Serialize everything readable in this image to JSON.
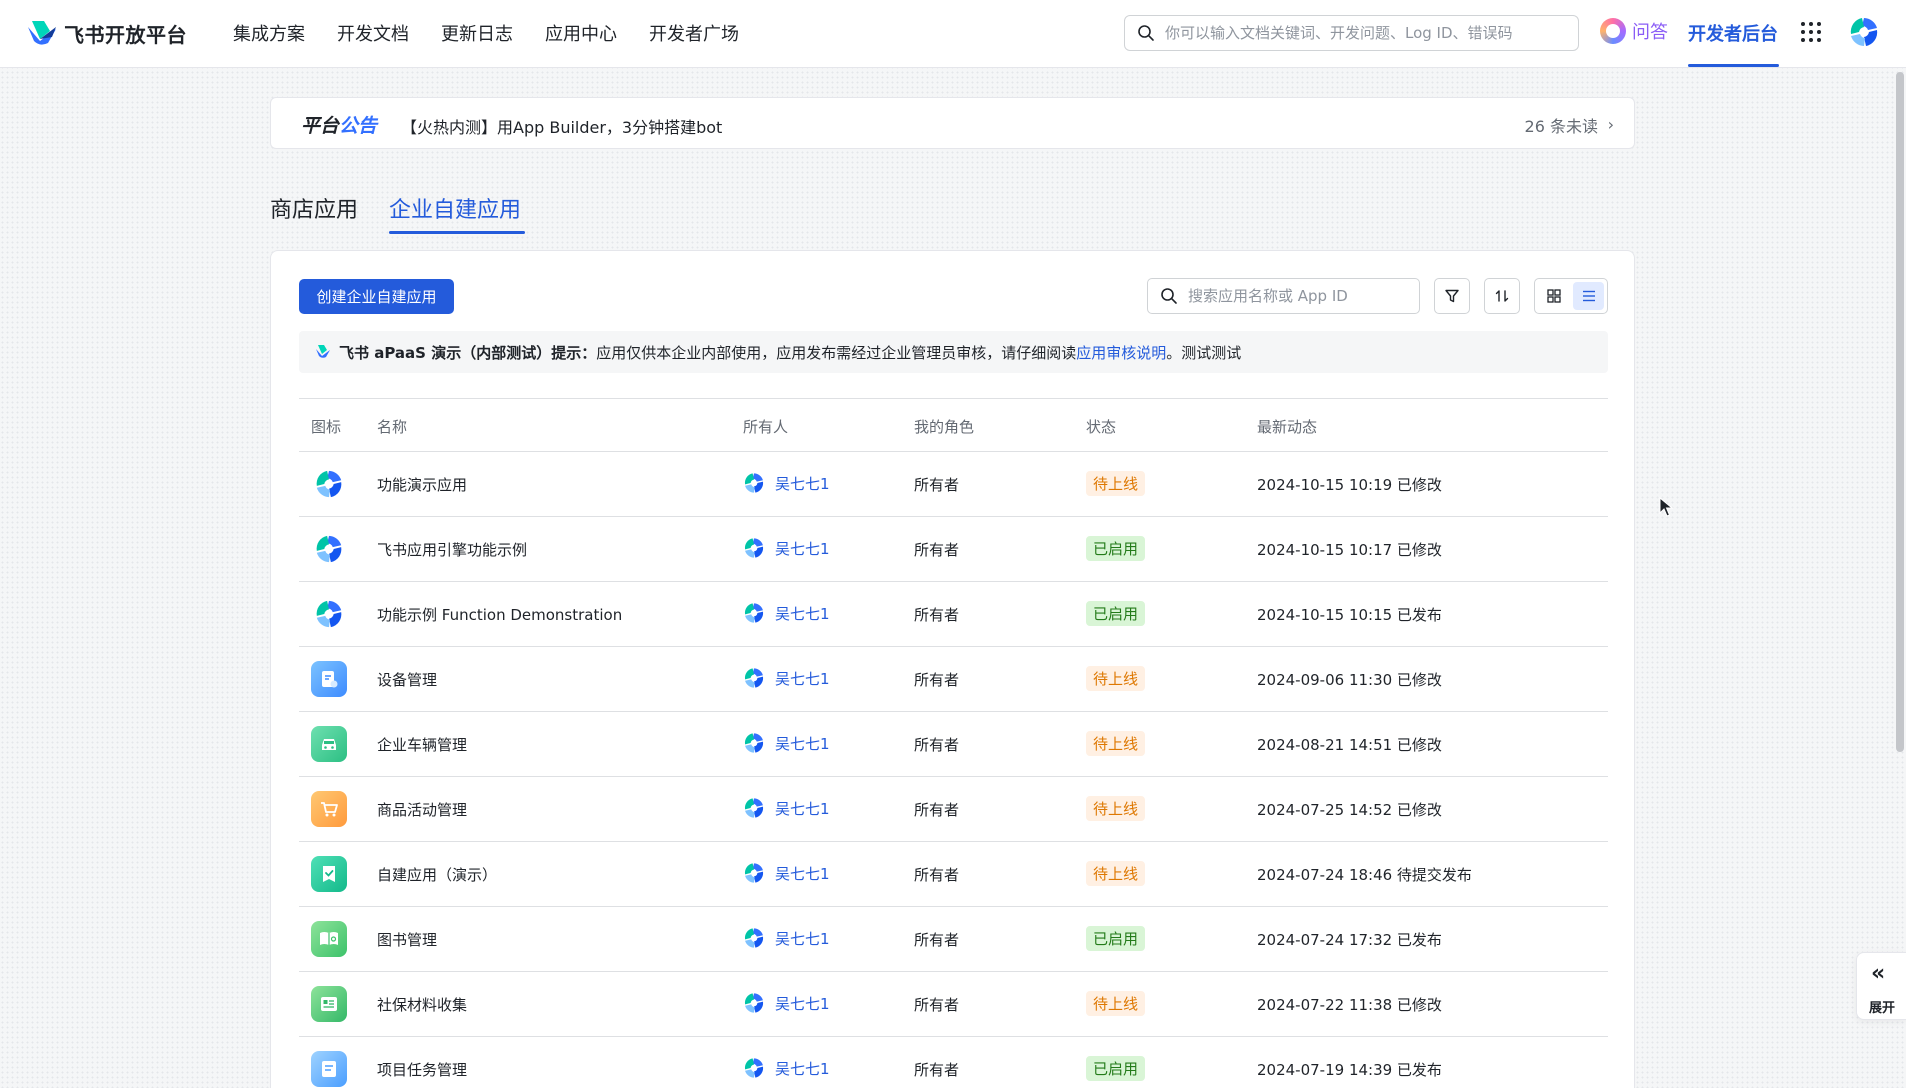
{
  "topnav": {
    "brand": "飞书开放平台",
    "links": [
      "集成方案",
      "开发文档",
      "更新日志",
      "应用中心",
      "开发者广场"
    ],
    "search_placeholder": "你可以输入文档关键词、开发问题、Log ID、错误码",
    "ask_label": "问答",
    "dev_console": "开发者后台"
  },
  "announcement": {
    "title_part1": "平台",
    "title_part2": "公告",
    "text": "【火热内测】用App Builder，3分钟搭建bot",
    "unread": "26 条未读",
    "chevron": "›"
  },
  "tabs": [
    "商店应用",
    "企业自建应用"
  ],
  "toolbar": {
    "create_button": "创建企业自建应用",
    "search_placeholder": "搜索应用名称或 App ID"
  },
  "notice": {
    "org_prefix": "飞书 aPaaS 演示（内部测试）提示：",
    "text": "应用仅供本企业内部使用，应用发布需经过企业管理员审核，请仔细阅读 ",
    "link": "应用审核说明",
    "suffix": "。测试测试"
  },
  "table": {
    "headers": [
      "图标",
      "名称",
      "所有人",
      "我的角色",
      "状态",
      "最新动态"
    ],
    "rows": [
      {
        "icon": "lark-logo-icon",
        "name": "功能演示应用",
        "owner": "吴七七1",
        "role": "所有者",
        "status": "待上线",
        "status_type": "pending",
        "date": "2024-10-15 10:19 已修改"
      },
      {
        "icon": "lark-logo-icon",
        "name": "飞书应用引擎功能示例",
        "owner": "吴七七1",
        "role": "所有者",
        "status": "已启用",
        "status_type": "enabled",
        "date": "2024-10-15 10:17 已修改"
      },
      {
        "icon": "lark-logo-icon",
        "name": "功能示例 Function Demonstration",
        "owner": "吴七七1",
        "role": "所有者",
        "status": "已启用",
        "status_type": "enabled",
        "date": "2024-10-15 10:15 已发布"
      },
      {
        "icon": "device-management-icon",
        "name": "设备管理",
        "owner": "吴七七1",
        "role": "所有者",
        "status": "待上线",
        "status_type": "pending",
        "date": "2024-09-06 11:30 已修改"
      },
      {
        "icon": "car-icon",
        "name": "企业车辆管理",
        "owner": "吴七七1",
        "role": "所有者",
        "status": "待上线",
        "status_type": "pending",
        "date": "2024-08-21 14:51 已修改"
      },
      {
        "icon": "shopping-cart-icon",
        "name": "商品活动管理",
        "owner": "吴七七1",
        "role": "所有者",
        "status": "待上线",
        "status_type": "pending",
        "date": "2024-07-25 14:52 已修改"
      },
      {
        "icon": "checklist-icon",
        "name": "自建应用（演示）",
        "owner": "吴七七1",
        "role": "所有者",
        "status": "待上线",
        "status_type": "pending",
        "date": "2024-07-24 18:46 待提交发布"
      },
      {
        "icon": "book-icon",
        "name": "图书管理",
        "owner": "吴七七1",
        "role": "所有者",
        "status": "已启用",
        "status_type": "enabled",
        "date": "2024-07-24 17:32 已发布"
      },
      {
        "icon": "document-icon",
        "name": "社保材料收集",
        "owner": "吴七七1",
        "role": "所有者",
        "status": "待上线",
        "status_type": "pending",
        "date": "2024-07-22 11:38 已修改"
      },
      {
        "icon": "task-icon",
        "name": "项目任务管理",
        "owner": "吴七七1",
        "role": "所有者",
        "status": "已启用",
        "status_type": "enabled",
        "date": "2024-07-19 14:39 已发布"
      }
    ]
  },
  "expand": {
    "chevron": "«",
    "label": "展开"
  },
  "colors": {
    "accent": "#245bdb",
    "pending_bg": "#fff0e3",
    "pending_fg": "#de7802",
    "enabled_bg": "#d9f5d6",
    "enabled_fg": "#237b19"
  }
}
